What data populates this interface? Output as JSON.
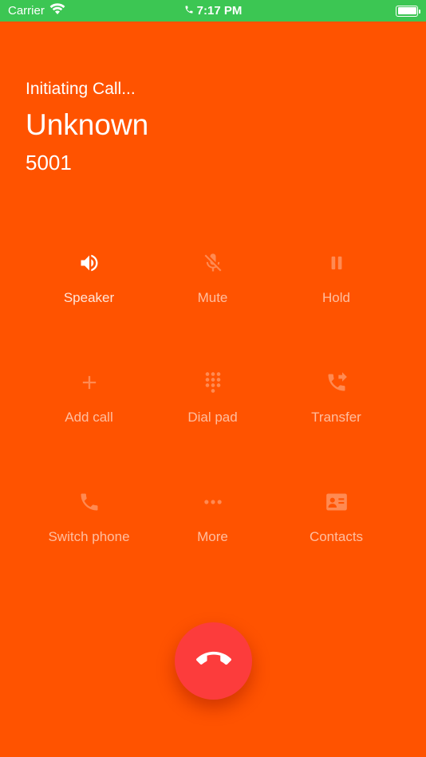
{
  "status_bar": {
    "carrier": "Carrier",
    "time": "7:17 PM"
  },
  "call": {
    "status": "Initiating Call...",
    "name": "Unknown",
    "number": "5001"
  },
  "actions": [
    {
      "label": "Speaker",
      "icon": "speaker-icon"
    },
    {
      "label": "Mute",
      "icon": "mic-off-icon"
    },
    {
      "label": "Hold",
      "icon": "pause-icon"
    },
    {
      "label": "Add call",
      "icon": "plus-icon"
    },
    {
      "label": "Dial pad",
      "icon": "dialpad-icon"
    },
    {
      "label": "Transfer",
      "icon": "phone-forward-icon"
    },
    {
      "label": "Switch phone",
      "icon": "phone-icon"
    },
    {
      "label": "More",
      "icon": "more-icon"
    },
    {
      "label": "Contacts",
      "icon": "contact-card-icon"
    }
  ],
  "colors": {
    "background": "#ff5300",
    "status_bar": "#3cc653",
    "hangup": "#fc3c3c"
  }
}
